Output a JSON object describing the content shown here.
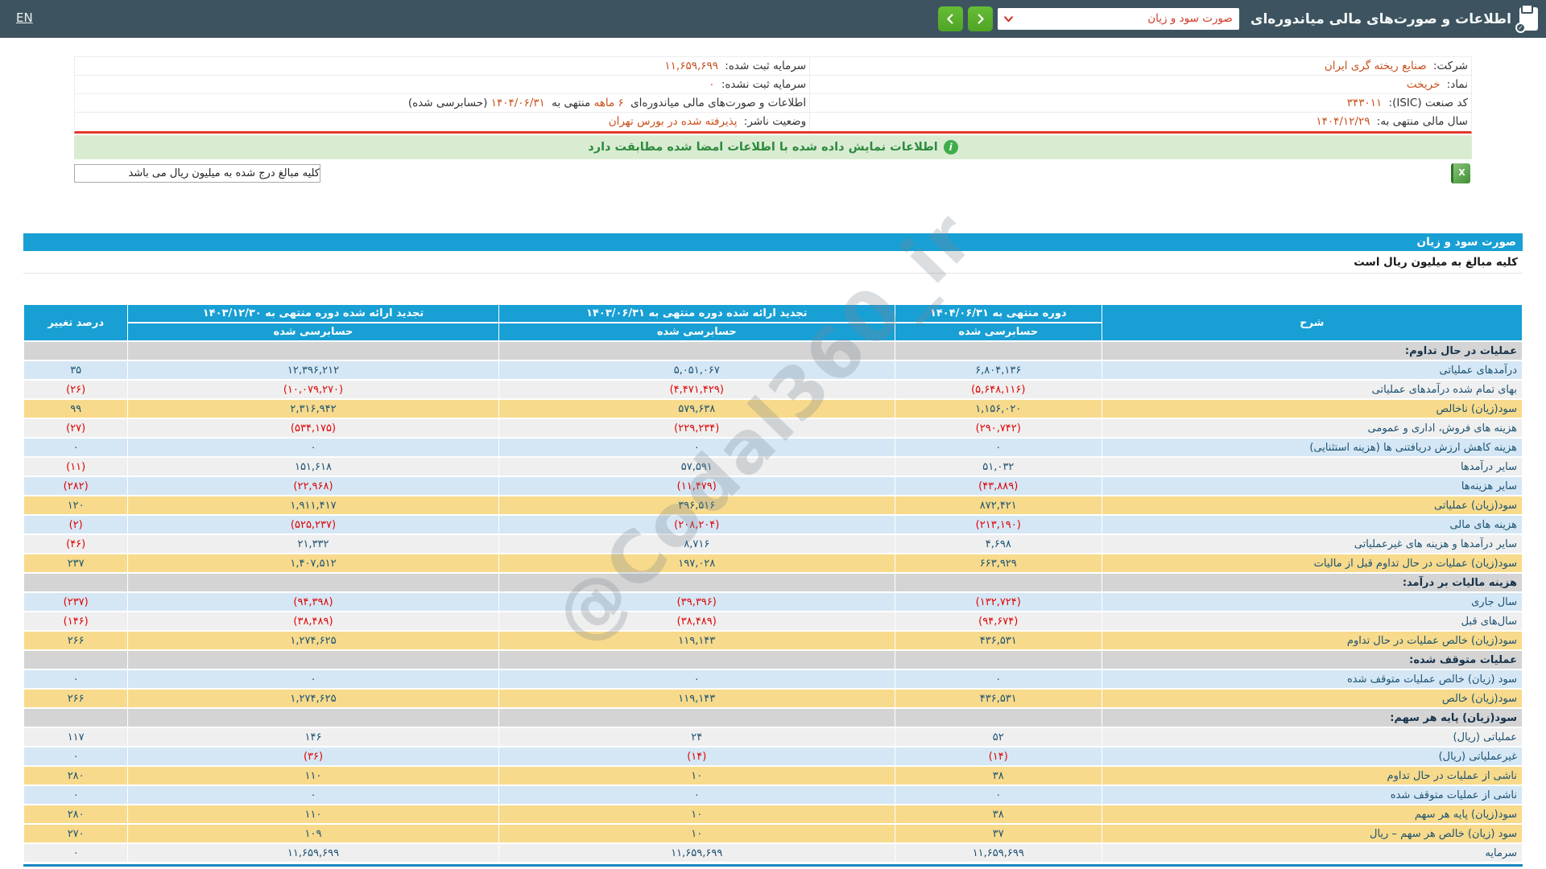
{
  "colors": {
    "topbar": "#3d5460",
    "teal": "#189fd4",
    "green_button": "#58b32c",
    "notice_bg": "#d9ecd2",
    "notice_text": "#2e8b3e",
    "value_orange": "#c9501c",
    "negative_red": "#e00404",
    "navy": "#1d5272",
    "row_blue": "#d5e7f5",
    "row_white": "#efefef",
    "row_yellow": "#f7da8b",
    "row_gray": "#d4d4d4",
    "table_bottom_blue": "#1787c0",
    "red_line": "#e2382c"
  },
  "icons": {
    "title_icon": "clipboard-check-icon",
    "select_icon": "chevron-down-icon",
    "next_icon": "chevron-right-icon",
    "prev_icon": "chevron-left-icon",
    "notice_icon": "info-circle-icon",
    "excel_icon": "excel-export-icon",
    "excel_glyph": "X",
    "check_glyph": "✓"
  },
  "topbar": {
    "en": "EN",
    "title": "اطلاعات و صورت‌های مالی میاندوره‌ای",
    "statement_select": "صورت سود و زیان"
  },
  "company": {
    "company_label": "شرکت:",
    "company_value": "صنایع ریخته گری ایران",
    "symbol_label": "نماد:",
    "symbol_value": "خریخت",
    "isic_label": "کد صنعت (ISIC):",
    "isic_value": "۳۴۳۰۱۱",
    "fiscal_label": "سال مالی منتهی به:",
    "fiscal_value": "۱۴۰۴/۱۲/۲۹",
    "registered_capital_label": "سرمایه ثبت شده:",
    "registered_capital_value": "۱۱,۶۵۹,۶۹۹",
    "unregistered_capital_label": "سرمایه ثبت نشده:",
    "unregistered_capital_value": "۰",
    "period_text_1": "اطلاعات و صورت‌های مالی میاندوره‌ای",
    "period_months": "۶ ماهه",
    "period_text_2": "منتهی به",
    "period_date": "۱۴۰۴/۰۶/۳۱",
    "period_text_3": "(حسابرسی شده)",
    "issuer_status_label": "وضعیت ناشر:",
    "issuer_status_value": "پذیرفته شده در بورس تهران"
  },
  "notice": "اطلاعات نمایش داده شده با اطلاعات امضا شده مطابقت دارد",
  "units_box": "کلیه مبالغ درج شده به میلیون ریال می باشد",
  "statement": {
    "title": "صورت سود و زیان",
    "units_note": "کلیه مبالغ به میلیون ریال است",
    "watermark": "@Codal360_ir",
    "header": {
      "desc": "شرح",
      "col_current": "دوره منتهی به ۱۴۰۴/۰۶/۳۱",
      "col_restated_mid": "تجدید ارائه شده دوره منتهی به ۱۴۰۳/۰۶/۳۱",
      "col_restated_year": "تجدید ارائه شده دوره منتهی به ۱۴۰۳/۱۲/۳۰",
      "pct": "درصد تغییر",
      "audited": "حسابرسی شده"
    },
    "rows": [
      {
        "type": "section",
        "label": "عملیات در حال تداوم:"
      },
      {
        "type": "data",
        "bg": "blue",
        "label": "درآمدهای عملیاتی",
        "c1": "۶,۸۰۴,۱۳۶",
        "c2": "۵,۰۵۱,۰۶۷",
        "c3": "۱۲,۳۹۶,۲۱۲",
        "pct": "۳۵"
      },
      {
        "type": "data",
        "bg": "white",
        "label": "بهای تمام شده درآمدهای عملیاتی",
        "c1": "(۵,۶۴۸,۱۱۶)",
        "c2": "(۴,۴۷۱,۴۲۹)",
        "c3": "(۱۰,۰۷۹,۲۷۰)",
        "pct": "(۲۶)"
      },
      {
        "type": "data",
        "bg": "yellow",
        "label": "سود(زیان) ناخالص",
        "c1": "۱,۱۵۶,۰۲۰",
        "c2": "۵۷۹,۶۳۸",
        "c3": "۲,۳۱۶,۹۴۲",
        "pct": "۹۹"
      },
      {
        "type": "data",
        "bg": "white",
        "label": "هزینه های فروش، اداری و عمومی",
        "c1": "(۲۹۰,۷۴۲)",
        "c2": "(۲۲۹,۲۳۴)",
        "c3": "(۵۳۴,۱۷۵)",
        "pct": "(۲۷)"
      },
      {
        "type": "data",
        "bg": "blue",
        "label": "هزینه کاهش ارزش دریافتنی ها (هزینه استثنایی)",
        "c1": "۰",
        "c2": "۰",
        "c3": "۰",
        "pct": "۰"
      },
      {
        "type": "data",
        "bg": "white",
        "label": "سایر درآمدها",
        "c1": "۵۱,۰۳۲",
        "c2": "۵۷,۵۹۱",
        "c3": "۱۵۱,۶۱۸",
        "pct": "(۱۱)"
      },
      {
        "type": "data",
        "bg": "blue",
        "label": "سایر هزینه‌ها",
        "c1": "(۴۳,۸۸۹)",
        "c2": "(۱۱,۴۷۹)",
        "c3": "(۲۲,۹۶۸)",
        "pct": "(۲۸۲)"
      },
      {
        "type": "data",
        "bg": "yellow",
        "label": "سود(زیان) عملیاتی",
        "c1": "۸۷۲,۴۲۱",
        "c2": "۳۹۶,۵۱۶",
        "c3": "۱,۹۱۱,۴۱۷",
        "pct": "۱۲۰"
      },
      {
        "type": "data",
        "bg": "blue",
        "label": "هزینه های مالی",
        "c1": "(۲۱۳,۱۹۰)",
        "c2": "(۲۰۸,۲۰۴)",
        "c3": "(۵۲۵,۲۳۷)",
        "pct": "(۲)"
      },
      {
        "type": "data",
        "bg": "white",
        "label": "سایر درآمدها و هزینه های غیرعملیاتی",
        "c1": "۴,۶۹۸",
        "c2": "۸,۷۱۶",
        "c3": "۲۱,۳۳۲",
        "pct": "(۴۶)"
      },
      {
        "type": "data",
        "bg": "yellow",
        "label": "سود(زیان) عملیات در حال تداوم قبل از مالیات",
        "c1": "۶۶۳,۹۲۹",
        "c2": "۱۹۷,۰۲۸",
        "c3": "۱,۴۰۷,۵۱۲",
        "pct": "۲۳۷"
      },
      {
        "type": "section",
        "label": "هزینه مالیات بر درآمد:"
      },
      {
        "type": "data",
        "bg": "blue",
        "label": "سال جاری",
        "c1": "(۱۳۲,۷۲۴)",
        "c2": "(۳۹,۳۹۶)",
        "c3": "(۹۴,۳۹۸)",
        "pct": "(۲۳۷)"
      },
      {
        "type": "data",
        "bg": "white",
        "label": "سال‌های قبل",
        "c1": "(۹۴,۶۷۴)",
        "c2": "(۳۸,۴۸۹)",
        "c3": "(۳۸,۴۸۹)",
        "pct": "(۱۴۶)"
      },
      {
        "type": "data",
        "bg": "yellow",
        "label": "سود(زیان) خالص عملیات در حال تداوم",
        "c1": "۴۳۶,۵۳۱",
        "c2": "۱۱۹,۱۴۳",
        "c3": "۱,۲۷۴,۶۲۵",
        "pct": "۲۶۶"
      },
      {
        "type": "section",
        "label": "عملیات متوقف شده:"
      },
      {
        "type": "data",
        "bg": "blue",
        "label": "سود (زیان) خالص عملیات متوقف شده",
        "c1": "۰",
        "c2": "۰",
        "c3": "۰",
        "pct": "۰"
      },
      {
        "type": "data",
        "bg": "yellow",
        "label": "سود(زیان) خالص",
        "c1": "۴۳۶,۵۳۱",
        "c2": "۱۱۹,۱۴۳",
        "c3": "۱,۲۷۴,۶۲۵",
        "pct": "۲۶۶"
      },
      {
        "type": "section",
        "label": "سود(زیان) پایه هر سهم:"
      },
      {
        "type": "data",
        "bg": "white",
        "label": "عملیاتی (ریال)",
        "c1": "۵۲",
        "c2": "۲۴",
        "c3": "۱۴۶",
        "pct": "۱۱۷"
      },
      {
        "type": "data",
        "bg": "blue",
        "label": "غیرعملیاتی (ریال)",
        "c1": "(۱۴)",
        "c2": "(۱۴)",
        "c3": "(۳۶)",
        "pct": "۰"
      },
      {
        "type": "data",
        "bg": "yellow",
        "label": "ناشی از عملیات در حال تداوم",
        "c1": "۳۸",
        "c2": "۱۰",
        "c3": "۱۱۰",
        "pct": "۲۸۰"
      },
      {
        "type": "data",
        "bg": "blue",
        "label": "ناشی از عملیات متوقف شده",
        "c1": "۰",
        "c2": "۰",
        "c3": "۰",
        "pct": "۰"
      },
      {
        "type": "data",
        "bg": "yellow",
        "label": "سود(زیان) پایه هر سهم",
        "c1": "۳۸",
        "c2": "۱۰",
        "c3": "۱۱۰",
        "pct": "۲۸۰"
      },
      {
        "type": "data",
        "bg": "yellow",
        "label": "سود (زیان) خالص هر سهم – ریال",
        "c1": "۳۷",
        "c2": "۱۰",
        "c3": "۱۰۹",
        "pct": "۲۷۰"
      },
      {
        "type": "data",
        "bg": "white",
        "label": "سرمایه",
        "c1": "۱۱,۶۵۹,۶۹۹",
        "c2": "۱۱,۶۵۹,۶۹۹",
        "c3": "۱۱,۶۵۹,۶۹۹",
        "pct": "۰"
      }
    ]
  }
}
